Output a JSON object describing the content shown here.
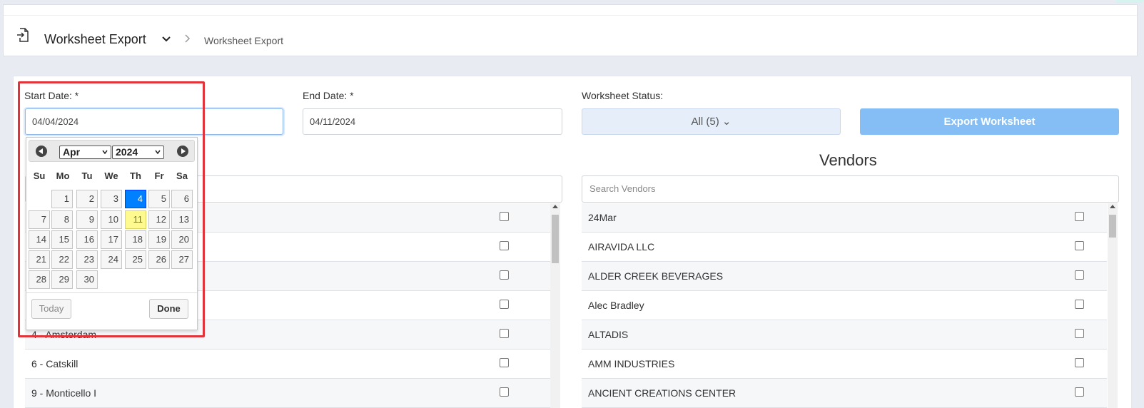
{
  "header": {
    "title": "Worksheet Export",
    "breadcrumb_sep": ">",
    "breadcrumb": "Worksheet Export",
    "icon": "export-page-icon"
  },
  "form": {
    "start_date_label": "Start Date: *",
    "start_date_value": "04/04/2024",
    "end_date_label": "End Date: *",
    "end_date_value": "04/11/2024",
    "status_label": "Worksheet Status:",
    "status_value": "All (5) ⌄",
    "export_label": "Export Worksheet"
  },
  "datepicker": {
    "month": "Apr",
    "year": "2024",
    "weekdays": [
      "Su",
      "Mo",
      "Tu",
      "We",
      "Th",
      "Fr",
      "Sa"
    ],
    "days": [
      "1",
      "2",
      "3",
      "4",
      "5",
      "6",
      "7",
      "8",
      "9",
      "10",
      "11",
      "12",
      "13",
      "14",
      "15",
      "16",
      "17",
      "18",
      "19",
      "20",
      "21",
      "22",
      "23",
      "24",
      "25",
      "26",
      "27",
      "28",
      "29",
      "30"
    ],
    "selected_day": "4",
    "today_day": "11",
    "today_label": "Today",
    "done_label": "Done"
  },
  "stores": {
    "search_placeholder": "",
    "items": [
      "",
      "",
      "",
      "",
      "4 - Amsterdam",
      "6 - Catskill",
      "9 - Monticello I"
    ]
  },
  "vendors": {
    "title": "Vendors",
    "search_placeholder": "Search Vendors",
    "items": [
      "24Mar",
      "AIRAVIDA LLC",
      "ALDER CREEK BEVERAGES",
      "Alec Bradley",
      "ALTADIS",
      "AMM INDUSTRIES",
      "ANCIENT CREATIONS CENTER"
    ]
  }
}
